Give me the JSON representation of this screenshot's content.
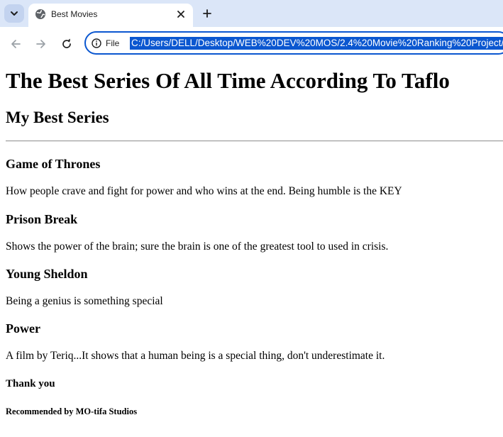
{
  "browser": {
    "tab_title": "Best Movies",
    "site_info_label": "File",
    "url": "C:/Users/DELL/Desktop/WEB%20DEV%20MOS/2.4%20Movie%20Ranking%20Project/",
    "icons": {
      "tab_search": "chevron-down-icon",
      "favicon": "globe-icon",
      "close": "close-icon",
      "new_tab": "plus-icon",
      "back": "arrow-left-icon",
      "forward": "arrow-right-icon",
      "reload": "reload-icon",
      "site_info": "info-icon"
    },
    "colors": {
      "tabstrip": "#dbe6f8",
      "accent": "#0b57d0"
    }
  },
  "page": {
    "title": "The Best Series Of All Time According To Taflo",
    "subtitle": "My Best Series",
    "series": [
      {
        "name": "Game of Thrones",
        "description": "How people crave and fight for power and who wins at the end. Being humble is the KEY"
      },
      {
        "name": "Prison Break",
        "description": "Shows the power of the brain; sure the brain is one of the greatest tool to used in crisis."
      },
      {
        "name": "Young Sheldon",
        "description": "Being a genius is something special"
      },
      {
        "name": "Power",
        "description": "A film by Teriq...It shows that a human being is a special thing, don't underestimate it."
      }
    ],
    "thanks": "Thank you",
    "recommended": "Recommended by MO-tifa Studios"
  }
}
